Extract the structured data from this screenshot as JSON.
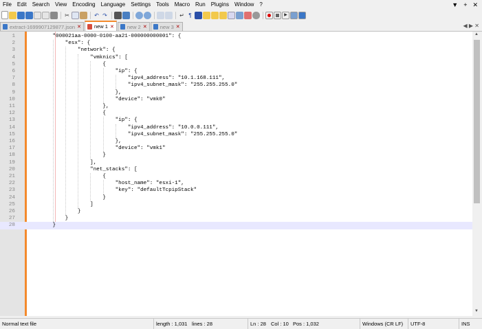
{
  "menu": [
    "File",
    "Edit",
    "Search",
    "View",
    "Encoding",
    "Language",
    "Settings",
    "Tools",
    "Macro",
    "Run",
    "Plugins",
    "Window",
    "?"
  ],
  "window_controls": {
    "arrow": "▼",
    "add": "+",
    "close": "✕"
  },
  "toolbar_icons": [
    "new-file-icon",
    "open-file-icon",
    "save-icon",
    "save-all-icon",
    "close-icon",
    "close-all-icon",
    "print-icon",
    "cut-icon",
    "copy-icon",
    "paste-icon",
    "undo-icon",
    "redo-icon",
    "find-icon",
    "replace-icon",
    "zoom-in-icon",
    "zoom-out-icon",
    "sync-vertical-icon",
    "sync-horizontal-icon",
    "word-wrap-icon",
    "all-chars-icon",
    "indent-guide-icon",
    "doc-map-icon",
    "function-list-icon",
    "folder-workspace-icon",
    "doc-list-icon",
    "monitoring-icon",
    "record-macro-icon",
    "stop-record-icon",
    "play-macro-icon",
    "run-macro-multiple-icon",
    "save-macro-icon"
  ],
  "tabs": [
    {
      "label": "extract-1699907129877.json",
      "active": false
    },
    {
      "label": "new 1",
      "active": true
    },
    {
      "label": "new 2",
      "active": false
    },
    {
      "label": "new 3",
      "active": false
    }
  ],
  "tab_arrows": "◀ ▶ ✕",
  "lines": [
    {
      "n": "1",
      "text": "        \"000021aa-0000-0100-aa21-000000000001\": {"
    },
    {
      "n": "2",
      "text": "            \"esx\": {"
    },
    {
      "n": "3",
      "text": "                \"network\": {"
    },
    {
      "n": "4",
      "text": "                    \"vmknics\": ["
    },
    {
      "n": "5",
      "text": "                        {"
    },
    {
      "n": "6",
      "text": "                            \"ip\": {"
    },
    {
      "n": "7",
      "text": "                                \"ipv4_address\": \"10.1.168.111\","
    },
    {
      "n": "8",
      "text": "                                \"ipv4_subnet_mask\": \"255.255.255.0\""
    },
    {
      "n": "9",
      "text": "                            },"
    },
    {
      "n": "10",
      "text": "                            \"device\": \"vmk0\""
    },
    {
      "n": "11",
      "text": "                        },"
    },
    {
      "n": "12",
      "text": "                        {"
    },
    {
      "n": "13",
      "text": "                            \"ip\": {"
    },
    {
      "n": "14",
      "text": "                                \"ipv4_address\": \"10.0.0.111\","
    },
    {
      "n": "15",
      "text": "                                \"ipv4_subnet_mask\": \"255.255.255.0\""
    },
    {
      "n": "16",
      "text": "                            },"
    },
    {
      "n": "17",
      "text": "                            \"device\": \"vmk1\""
    },
    {
      "n": "18",
      "text": "                        }"
    },
    {
      "n": "19",
      "text": "                    ],"
    },
    {
      "n": "20",
      "text": "                    \"net_stacks\": ["
    },
    {
      "n": "21",
      "text": "                        {"
    },
    {
      "n": "22",
      "text": "                            \"host_name\": \"esxi-1\","
    },
    {
      "n": "23",
      "text": "                            \"key\": \"defaultTcpipStack\""
    },
    {
      "n": "24",
      "text": "                        }"
    },
    {
      "n": "25",
      "text": "                    ]"
    },
    {
      "n": "26",
      "text": "                }"
    },
    {
      "n": "27",
      "text": "            }"
    },
    {
      "n": "28",
      "text": "        }"
    }
  ],
  "status": {
    "type": "Normal text file",
    "length": "length : 1,031",
    "lines": "lines : 28",
    "ln": "Ln : 28",
    "col": "Col : 10",
    "pos": "Pos : 1,032",
    "eol": "Windows (CR LF)",
    "encoding": "UTF-8",
    "mode": "INS"
  }
}
